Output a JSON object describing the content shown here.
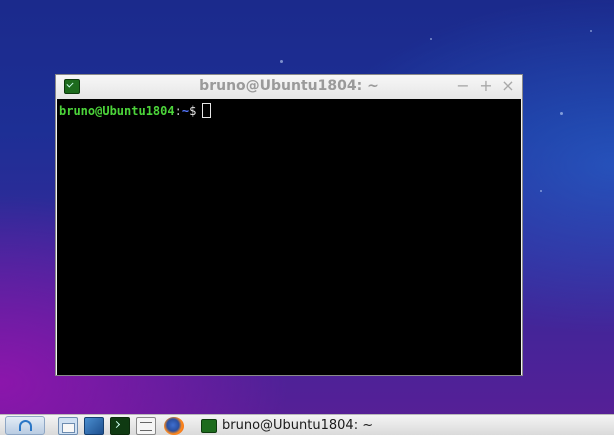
{
  "window": {
    "title": "bruno@Ubuntu1804: ~",
    "buttons": {
      "minimize": "−",
      "maximize": "+",
      "close": "×"
    }
  },
  "terminal": {
    "user_host": "bruno@Ubuntu1804",
    "separator": ":",
    "path": "~",
    "prompt_symbol": "$"
  },
  "taskbar": {
    "launchers": [
      "file-manager-icon",
      "screenshot-icon",
      "terminal-icon",
      "text-editor-icon",
      "firefox-icon"
    ],
    "tasks": [
      {
        "label": "bruno@Ubuntu1804: ~",
        "icon": "terminal-icon"
      }
    ]
  },
  "colors": {
    "prompt_user": "#4cd43a",
    "prompt_path": "#5577ff",
    "terminal_bg": "#000000"
  }
}
